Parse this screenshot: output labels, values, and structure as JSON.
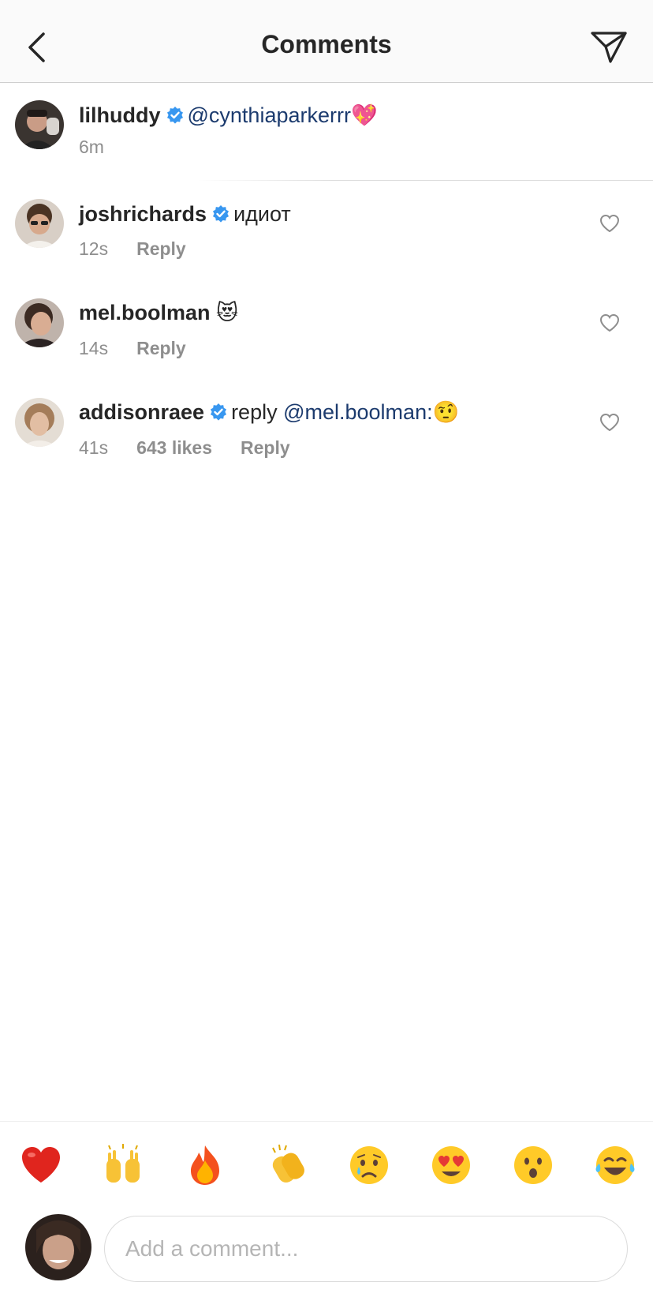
{
  "header": {
    "title": "Comments",
    "back_icon": "chevron-left-icon",
    "send_icon": "paper-plane-icon"
  },
  "caption": {
    "username": "lilhuddy",
    "verified": true,
    "mention": "@cynthiaparkerrr",
    "emoji": "💖",
    "time": "6m"
  },
  "comments": [
    {
      "username": "joshrichards",
      "verified": true,
      "text": "идиот",
      "time": "12s",
      "likes": "",
      "reply_label": "Reply"
    },
    {
      "username": "mel.boolman",
      "verified": false,
      "text": "😻",
      "time": "14s",
      "likes": "",
      "reply_label": "Reply"
    },
    {
      "username": "addisonraee",
      "verified": true,
      "text_prefix": "reply ",
      "mention": "@mel.boolman:",
      "emoji": "🤨",
      "time": "41s",
      "likes": "643 likes",
      "reply_label": "Reply"
    }
  ],
  "reactions": [
    "❤️",
    "🙌",
    "🔥",
    "👏",
    "😢",
    "😍",
    "😮",
    "😂"
  ],
  "composer": {
    "placeholder": "Add a comment..."
  },
  "colors": {
    "verified_blue": "#3897f0",
    "mention": "#1c3b6e",
    "meta_gray": "#8e8e8e"
  }
}
